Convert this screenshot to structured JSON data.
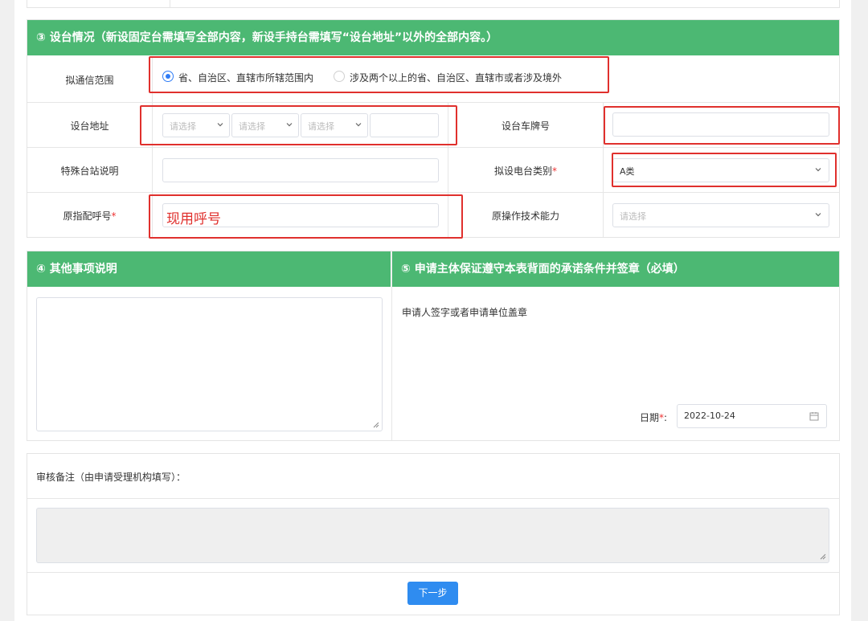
{
  "section3": {
    "title": "③ 设台情况（新设固定台需填写全部内容，新设手持台需填写“设台地址”以外的全部内容。）",
    "range_label": "拟通信范围",
    "range_option1": "省、自治区、直辖市所辖范围内",
    "range_option2": "涉及两个以上的省、自治区、直辖市或者涉及境外",
    "address_label": "设台地址",
    "address_placeholder": "请选择",
    "plate_label": "设台车牌号",
    "special_label": "特殊台站说明",
    "category_label": "拟设电台类别",
    "category_value": "A类",
    "callsign_label": "原指配呼号",
    "callsign_value": "现用呼号",
    "ability_label": "原操作技术能力",
    "ability_placeholder": "请选择",
    "required_mark": "*"
  },
  "section4": {
    "title": "④ 其他事项说明"
  },
  "section5": {
    "title": "⑤ 申请主体保证遵守本表背面的承诺条件并签章（必填）",
    "sign_text": "申请人签字或者申请单位盖章",
    "date_label": "日期",
    "date_value": "2022-10-24"
  },
  "review": {
    "label": "审核备注（由申请受理机构填写）："
  },
  "footer": {
    "next_button": "下一步"
  },
  "colors": {
    "header_green": "#4cb873",
    "highlight_red": "#e0302d",
    "primary_blue": "#2f8cf0"
  }
}
